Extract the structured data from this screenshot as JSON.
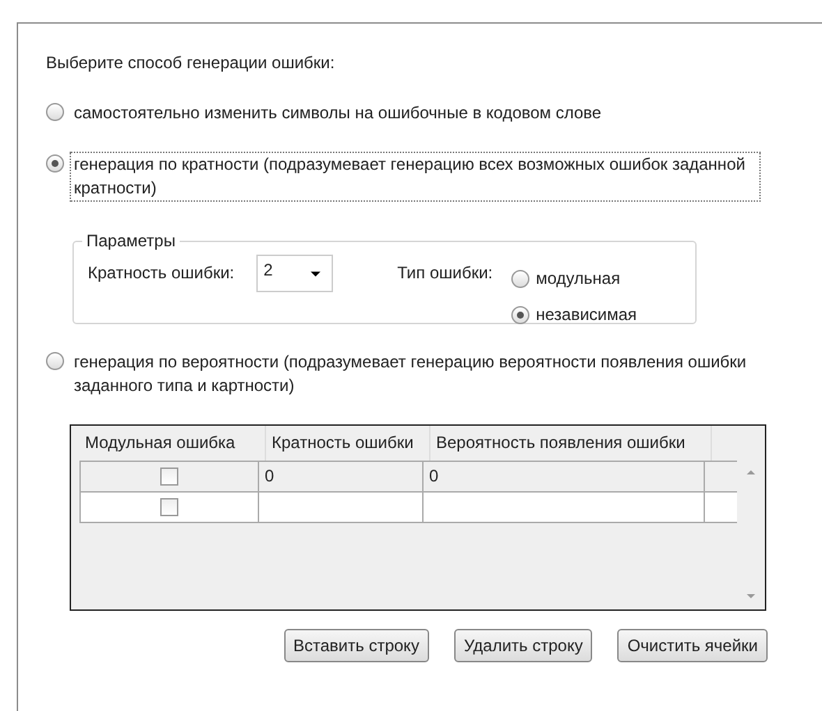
{
  "prompt": "Выберите способ генерации ошибки:",
  "options": [
    {
      "label": "самостоятельно изменить символы на ошибочные в кодовом слове",
      "selected": false,
      "focused": false
    },
    {
      "label": "генерация по кратности (подразумевает генерацию всех возможных ошибок заданной кратности)",
      "selected": true,
      "focused": true,
      "parameters": {
        "title": "Параметры",
        "multiplicity_label": "Кратность ошибки:",
        "multiplicity": "2",
        "type_label": "Тип ошибки:",
        "types": [
          {
            "label": "модульная",
            "selected": false
          },
          {
            "label": "независимая",
            "selected": true
          }
        ]
      }
    },
    {
      "label": "генерация по вероятности (подразумевает генерацию вероятности появления ошибки заданного типа и картности)",
      "selected": false,
      "focused": false,
      "table": {
        "columns": [
          "Модульная ошибка",
          "Кратность ошибки",
          "Вероятность появления ошибки"
        ],
        "rows": [
          {
            "selected": true,
            "modular": false,
            "multiplicity": "0",
            "probability": "0"
          },
          {
            "selected": false,
            "modular": false
          }
        ]
      }
    }
  ],
  "buttons": [
    "Вставить строку",
    "Удалить строку",
    "Очистить ячейки"
  ]
}
